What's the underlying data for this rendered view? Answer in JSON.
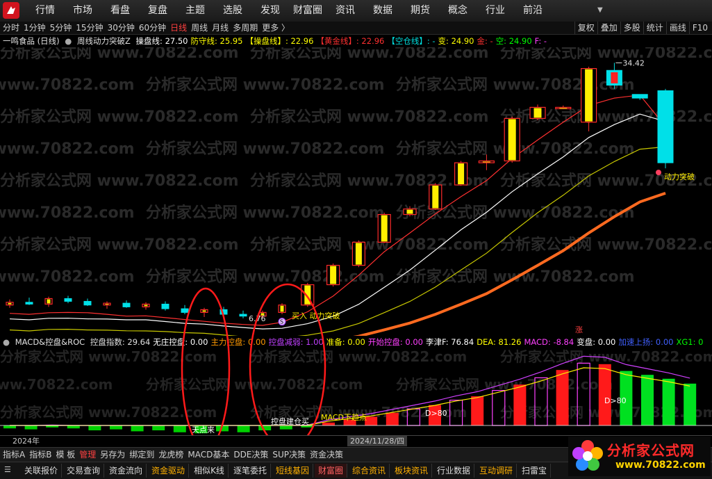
{
  "top_menu": [
    "行情",
    "市场",
    "看盘",
    "复盘",
    "主题",
    "选股",
    "发现",
    "财富圈",
    "资讯",
    "数据",
    "期货",
    "概念",
    "行业",
    "前沿"
  ],
  "period_tabs": [
    "分时",
    "1分钟",
    "5分钟",
    "15分钟",
    "30分钟",
    "60分钟",
    "日线",
    "周线",
    "月线",
    "多周期",
    "更多 〉"
  ],
  "active_period": "日线",
  "toolbar_right": [
    "复权",
    "叠加",
    "多股",
    "统计",
    "画线",
    "F10"
  ],
  "stock_title": "一鸣食品 (日线)",
  "indicator_name": "周线动力突破Z",
  "info_fields": [
    {
      "label": "操盘线: 27.50",
      "color": "#ffffff"
    },
    {
      "label": "防守线: 25.95",
      "color": "#ffff00"
    },
    {
      "label": "【操盘线】: 22.96",
      "color": "#ffff00"
    },
    {
      "label": "【黄金线】: 22.96",
      "color": "#ff3030"
    },
    {
      "label": "【空仓线】: -",
      "color": "#00e0e0"
    },
    {
      "label": "变: 24.90",
      "color": "#ffff00"
    },
    {
      "label": "金: -",
      "color": "#ff3030"
    },
    {
      "label": "空: 24.90",
      "color": "#00ff00"
    },
    {
      "label": "F: -",
      "color": "#ff40ff"
    }
  ],
  "macd_title": "MACD&控盘&ROC",
  "macd_fields": [
    {
      "label": "控盘指数: 29.64",
      "color": "#e0e0e0"
    },
    {
      "label": "无庄控盘: 0.00",
      "color": "#ffffff"
    },
    {
      "label": "主力控盘: 0.00",
      "color": "#ff9900"
    },
    {
      "label": "控盘减弱: 1.00",
      "color": "#c040ff"
    },
    {
      "label": "准备: 0.00",
      "color": "#ffff00"
    },
    {
      "label": "开始控盘: 0.00",
      "color": "#ff40ff"
    },
    {
      "label": "李津F: 76.84",
      "color": "#ffffff"
    },
    {
      "label": "DEA: 81.26",
      "color": "#ffff00"
    },
    {
      "label": "MACD: -8.84",
      "color": "#ff40ff"
    },
    {
      "label": "变盘: 0.00",
      "color": "#ffffff"
    },
    {
      "label": "加速上扬: 0.00",
      "color": "#4060ff"
    },
    {
      "label": "XG1: 0",
      "color": "#00ff00"
    }
  ],
  "chart_labels": {
    "high_price": "34.42",
    "low_price": "6.76",
    "breakout_top": "动力突破",
    "breakout_bottom": "买入 动力突破",
    "buy_marker": "S",
    "limit_up": "涨",
    "macd_d80_a": "D>80",
    "macd_d80_b": "D>80",
    "macd_bottom": "MACD下趋点",
    "macd_start": "天点来",
    "macd_cross": "控盘建仓买"
  },
  "watermark_text": "分析家公式网 www.70822.com",
  "date_axis": {
    "year": "2024年",
    "current": "2024/11/28/四"
  },
  "bottom_tabs": [
    "指标A",
    "指标B",
    "模 板",
    "管理",
    "另存为",
    "绑定到",
    "龙虎榜",
    "MACD基本",
    "DDE决策",
    "SUP决策",
    "资金决策"
  ],
  "bottom_tab_active": "管理",
  "bottom_bar": [
    "关联报价",
    "交易查询",
    "资金流向",
    "资金驱动",
    "相似K线",
    "逐笔委托",
    "短线基因",
    "财富圈",
    "综合资讯",
    "板块资讯",
    "行业数据",
    "互动调研",
    "扫雷宝"
  ],
  "bottom_bar_highlight": "财富圈",
  "bottom_bar_orange": [
    "资金驱动",
    "短线基因",
    "综合资讯",
    "板块资讯",
    "互动调研"
  ],
  "site_logo": {
    "name": "分析家公式网",
    "url": "www.70822.com"
  },
  "colors": {
    "up": "#ff2020",
    "down": "#00e0e0",
    "ma_fast": "#ff3030",
    "ma_slow": "#ffffff",
    "ma_mid": "#c8c800"
  },
  "candles": [
    {
      "o": 8.2,
      "h": 8.8,
      "l": 7.9,
      "c": 8.5
    },
    {
      "o": 8.5,
      "h": 9.0,
      "l": 8.2,
      "c": 8.3
    },
    {
      "o": 8.3,
      "h": 9.1,
      "l": 8.0,
      "c": 8.9
    },
    {
      "o": 8.9,
      "h": 9.2,
      "l": 8.4,
      "c": 8.6
    },
    {
      "o": 8.6,
      "h": 8.9,
      "l": 8.1,
      "c": 8.2
    },
    {
      "o": 8.2,
      "h": 8.6,
      "l": 7.8,
      "c": 8.4
    },
    {
      "o": 8.4,
      "h": 8.7,
      "l": 7.9,
      "c": 8.0
    },
    {
      "o": 8.0,
      "h": 8.5,
      "l": 7.7,
      "c": 8.3
    },
    {
      "o": 8.3,
      "h": 8.6,
      "l": 7.6,
      "c": 7.8
    },
    {
      "o": 7.8,
      "h": 8.2,
      "l": 7.2,
      "c": 7.4
    },
    {
      "o": 7.4,
      "h": 7.9,
      "l": 6.9,
      "c": 7.7
    },
    {
      "o": 7.7,
      "h": 8.0,
      "l": 7.0,
      "c": 7.2
    },
    {
      "o": 7.2,
      "h": 7.6,
      "l": 6.76,
      "c": 7.0
    },
    {
      "o": 7.0,
      "h": 7.6,
      "l": 6.8,
      "c": 7.4
    },
    {
      "o": 7.4,
      "h": 8.4,
      "l": 7.2,
      "c": 8.2
    },
    {
      "o": 8.2,
      "h": 10.6,
      "l": 8.0,
      "c": 10.4
    },
    {
      "o": 10.4,
      "h": 12.7,
      "l": 10.2,
      "c": 12.5
    },
    {
      "o": 12.5,
      "h": 15.2,
      "l": 12.3,
      "c": 15.0
    },
    {
      "o": 15.0,
      "h": 18.2,
      "l": 14.9,
      "c": 18.0
    },
    {
      "o": 18.0,
      "h": 18.9,
      "l": 17.8,
      "c": 18.6
    },
    {
      "o": 18.6,
      "h": 21.4,
      "l": 18.5,
      "c": 21.2
    },
    {
      "o": 21.2,
      "h": 23.8,
      "l": 21.1,
      "c": 23.6
    },
    {
      "o": 23.6,
      "h": 24.5,
      "l": 22.8,
      "c": 23.8
    },
    {
      "o": 23.8,
      "h": 28.6,
      "l": 23.6,
      "c": 28.4
    },
    {
      "o": 28.4,
      "h": 29.9,
      "l": 28.2,
      "c": 29.6
    },
    {
      "o": 29.6,
      "h": 29.8,
      "l": 29.4,
      "c": 29.6
    },
    {
      "o": 28.0,
      "h": 34.0,
      "l": 27.0,
      "c": 33.8
    },
    {
      "o": 33.6,
      "h": 34.42,
      "l": 31.6,
      "c": 32.0
    },
    {
      "o": 31.0,
      "h": 30.7,
      "l": 30.4,
      "c": 30.6
    },
    {
      "o": 31.4,
      "h": 31.6,
      "l": 23.0,
      "c": 23.6
    }
  ],
  "macd_bars": [
    -0.3,
    -0.4,
    -0.2,
    -0.3,
    -0.5,
    -0.4,
    -0.6,
    -0.5,
    -0.7,
    -0.8,
    -0.6,
    -0.7,
    -0.5,
    -0.4,
    -0.2,
    0.3,
    0.6,
    0.9,
    1.3,
    1.7,
    2.1,
    2.6,
    3.0,
    3.6,
    4.2,
    4.9,
    5.7,
    6.4,
    6.3,
    5.6,
    5.2,
    4.8,
    4.3
  ]
}
